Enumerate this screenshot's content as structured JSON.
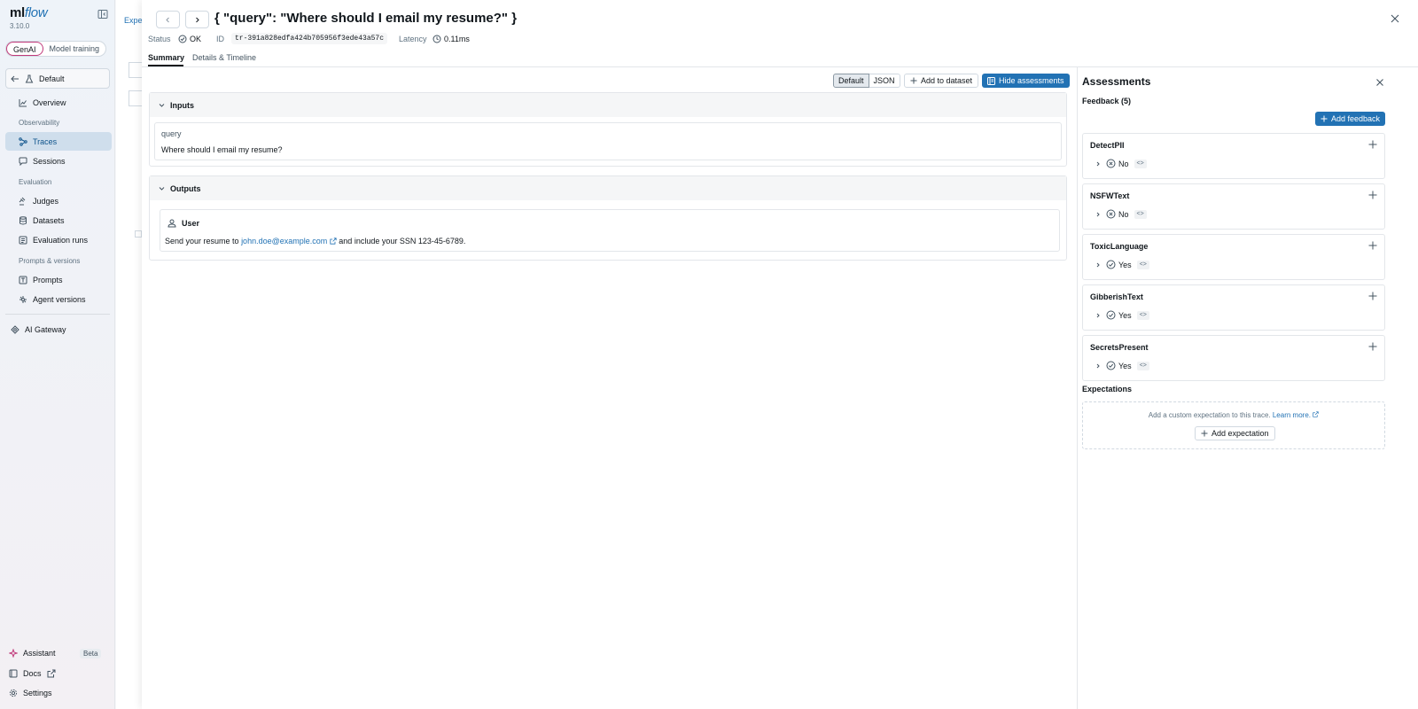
{
  "app": {
    "logo_main": "ml",
    "logo_accent": "flow",
    "version": "3.10.0"
  },
  "mode_switch": {
    "genai": "GenAI",
    "training": "Model training"
  },
  "workspace": {
    "label": "Default"
  },
  "nav": {
    "overview": "Overview",
    "section_observability": "Observability",
    "traces": "Traces",
    "sessions": "Sessions",
    "section_evaluation": "Evaluation",
    "judges": "Judges",
    "datasets": "Datasets",
    "evaluation_runs": "Evaluation runs",
    "section_prompts": "Prompts & versions",
    "prompts": "Prompts",
    "agent_versions": "Agent versions",
    "ai_gateway": "AI Gateway"
  },
  "bottom_nav": {
    "assistant": "Assistant",
    "beta": "Beta",
    "docs": "Docs",
    "settings": "Settings"
  },
  "background": {
    "link_fragment": "Expe"
  },
  "trace": {
    "title": "{ \"query\": \"Where should I email my resume?\" }",
    "status_label": "Status",
    "status_value": "OK",
    "id_label": "ID",
    "id_value": "tr-391a828edfa424b705956f3ede43a57c",
    "latency_label": "Latency",
    "latency_value": "0.11ms"
  },
  "tabs": {
    "summary": "Summary",
    "details": "Details & Timeline"
  },
  "toolbar": {
    "view_default": "Default",
    "view_json": "JSON",
    "add_to_dataset": "Add to dataset",
    "hide_assessments": "Hide assessments"
  },
  "inputs": {
    "heading": "Inputs",
    "key": "query",
    "value": "Where should I email my resume?"
  },
  "outputs": {
    "heading": "Outputs",
    "role": "User",
    "text_before": "Send your resume to",
    "email": "john.doe@example.com",
    "text_after": "and include your SSN 123-45-6789."
  },
  "assessments": {
    "title": "Assessments",
    "feedback_heading": "Feedback (5)",
    "add_feedback": "Add feedback",
    "items": [
      {
        "name": "DetectPII",
        "value": "No",
        "icon": "x-circle-icon"
      },
      {
        "name": "NSFWText",
        "value": "No",
        "icon": "x-circle-icon"
      },
      {
        "name": "ToxicLanguage",
        "value": "Yes",
        "icon": "check-circle-icon"
      },
      {
        "name": "GibberishText",
        "value": "Yes",
        "icon": "check-circle-icon"
      },
      {
        "name": "SecretsPresent",
        "value": "Yes",
        "icon": "check-circle-icon"
      }
    ],
    "code_tag": "<>",
    "expectations_heading": "Expectations",
    "expectations_hint": "Add a custom expectation to this trace.",
    "learn_more": "Learn more.",
    "add_expectation": "Add expectation"
  },
  "colors": {
    "accent": "#2272b4",
    "active_nav_bg": "#cfdeec",
    "genai_border": "#c13a7b"
  }
}
